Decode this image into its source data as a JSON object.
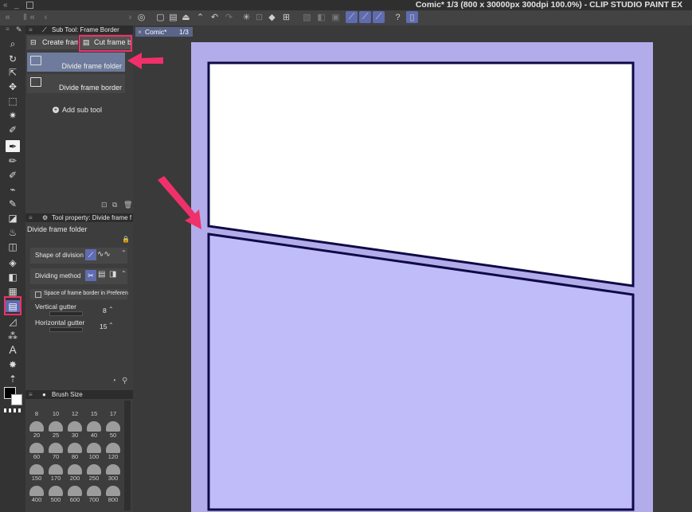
{
  "window": {
    "title": "Comic* 1/3 (800 x 30000px 300dpi 100.0%)  - CLIP STUDIO PAINT EX"
  },
  "document_tab": {
    "name": "Comic*",
    "page": "1/3"
  },
  "subtool_panel": {
    "title": "Sub Tool: Frame Border",
    "tabs": [
      {
        "label": "Create fram"
      },
      {
        "label": "Cut frame b"
      }
    ],
    "items": [
      {
        "label": "Divide frame folder",
        "selected": true
      },
      {
        "label": "Divide frame border",
        "selected": false
      }
    ],
    "add_label": "Add sub tool"
  },
  "tool_property_panel": {
    "title": "Tool property: Divide frame f",
    "subtitle": "Divide frame folder",
    "shape_of_division_label": "Shape of division",
    "dividing_method_label": "Dividing method",
    "space_checkbox_label": "Space of frame border in Preferen",
    "vertical_gutter_label": "Vertical gutter",
    "vertical_gutter_value": "8",
    "horizontal_gutter_label": "Horizontal gutter",
    "horizontal_gutter_value": "15"
  },
  "brush_size_panel": {
    "title": "Brush Size",
    "sizes": [
      "8",
      "10",
      "12",
      "15",
      "17",
      "20",
      "25",
      "30",
      "40",
      "50",
      "60",
      "70",
      "80",
      "100",
      "120",
      "150",
      "170",
      "200",
      "250",
      "300",
      "400",
      "500",
      "600",
      "700",
      "800"
    ]
  },
  "colors": {
    "accent_highlight": "#f0306a",
    "canvas_page": "#b3acea",
    "panel_bottom_fill": "#c0bcf9",
    "frame_border": "#0e0a46",
    "selection_blue": "#5f6cb0"
  }
}
